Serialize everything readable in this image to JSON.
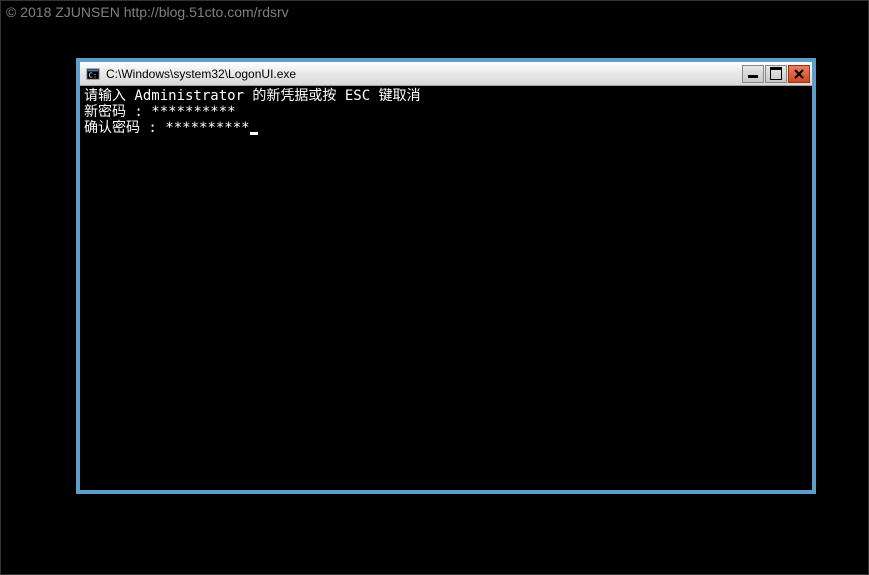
{
  "watermark": "© 2018 ZJUNSEN http://blog.51cto.com/rdsrv",
  "window": {
    "title": "C:\\Windows\\system32\\LogonUI.exe",
    "console": {
      "line1": "请输入 Administrator 的新凭据或按 ESC 键取消",
      "line2_label": "新密码 : ",
      "line2_value": "**********",
      "line3_label": "确认密码 : ",
      "line3_value": "**********"
    }
  }
}
